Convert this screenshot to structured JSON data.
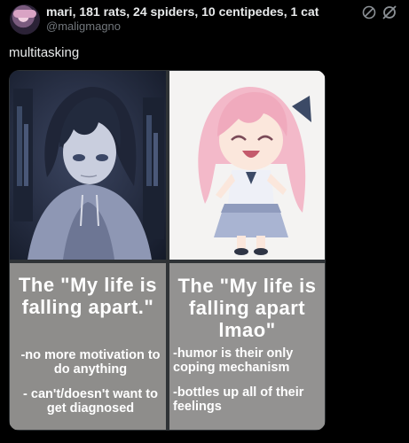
{
  "header": {
    "display_name": "mari, 181 rats, 24 spiders, 10 centipedes, 1 cat",
    "handle": "@maligmagno"
  },
  "post": {
    "text": "multitasking"
  },
  "meme": {
    "left": {
      "title": "The \"My life is falling apart.\"",
      "notes": [
        "-no more motivation to do anything",
        "- can't/doesn't want to get diagnosed"
      ]
    },
    "right": {
      "title": "The \"My life is falling apart lmao\"",
      "notes": [
        "-humor is their only coping mechanism",
        "-bottles up all of their feelings"
      ]
    }
  },
  "icons": [
    "avatar",
    "translate-off-icon",
    "grok-icon"
  ]
}
